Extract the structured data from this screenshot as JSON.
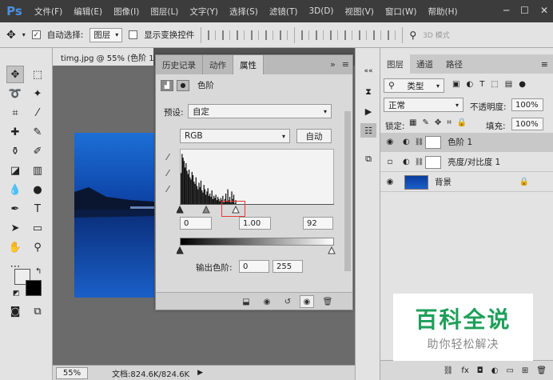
{
  "app": {
    "logo": "Ps"
  },
  "menu": [
    "文件(F)",
    "编辑(E)",
    "图像(I)",
    "图层(L)",
    "文字(Y)",
    "选择(S)",
    "滤镜(T)",
    "3D(D)",
    "视图(V)",
    "窗口(W)",
    "帮助(H)"
  ],
  "options": {
    "auto_select_label": "自动选择:",
    "auto_select_value": "图层",
    "show_transform_label": "显示变换控件",
    "mode_3d": "3D 模式"
  },
  "document": {
    "tab_title": "timg.jpg @ 55% (色阶 1",
    "zoom": "55%",
    "info": "文档:824.6K/824.6K"
  },
  "properties": {
    "tabs": [
      "历史记录",
      "动作",
      "属性"
    ],
    "title": "色阶",
    "preset_label": "预设:",
    "preset_value": "自定",
    "channel_value": "RGB",
    "auto_button": "自动",
    "input_black": "0",
    "input_gamma": "1.00",
    "input_white": "92",
    "output_label": "输出色阶:",
    "output_black": "0",
    "output_white": "255"
  },
  "histogram": {
    "input_max": 255,
    "white_point": 92,
    "bins": [
      60,
      95,
      88,
      82,
      70,
      78,
      64,
      58,
      66,
      52,
      48,
      62,
      56,
      44,
      40,
      52,
      36,
      30,
      42,
      34,
      46,
      28,
      24,
      38,
      30,
      20,
      26,
      32,
      18,
      22,
      16,
      28,
      12,
      18,
      14,
      20,
      10,
      16,
      12,
      8,
      14,
      10,
      18,
      6,
      12,
      22,
      8,
      30,
      10,
      16,
      6,
      26,
      12,
      20,
      4,
      10
    ]
  },
  "layers": {
    "tabs": [
      "图层",
      "通道",
      "路径"
    ],
    "filter_label": "类型",
    "blend_mode": "正常",
    "opacity_label": "不透明度:",
    "opacity_value": "100%",
    "lock_label": "锁定:",
    "fill_label": "填充:",
    "fill_value": "100%",
    "items": [
      {
        "name": "色阶 1",
        "visible": true,
        "selected": true
      },
      {
        "name": "亮度/对比度 1",
        "visible": false,
        "selected": false
      },
      {
        "name": "背景",
        "visible": true,
        "selected": false
      }
    ]
  },
  "watermark": {
    "title": "百科全说",
    "subtitle": "助你轻松解决"
  },
  "colors": {
    "menubar": "#3c3c3c",
    "panel": "#e3e3e3",
    "accent_green": "#1e9f5a",
    "marker_red": "#e53935"
  }
}
